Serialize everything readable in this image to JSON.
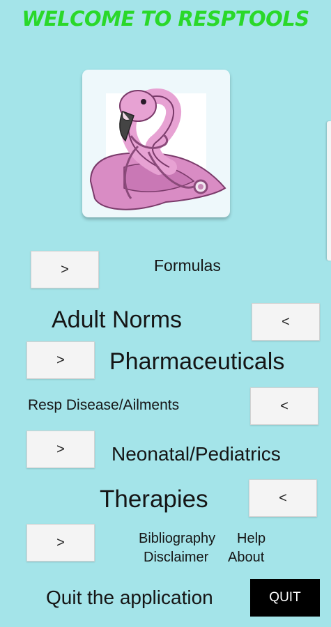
{
  "app": {
    "title": "WELCOME TO RESPTOOLS",
    "title_color": "#2ad82a",
    "background_color": "#a4e4e9",
    "logo_icon": "flamingo-with-stethoscope"
  },
  "menu": {
    "formulas": {
      "button_label": ">",
      "label": "Formulas"
    },
    "adult_norms": {
      "button_label": "<",
      "label": "Adult Norms"
    },
    "pharmaceuticals": {
      "button_label": ">",
      "label": "Pharmaceuticals"
    },
    "resp_disease": {
      "button_label": "<",
      "label": "Resp Disease/Ailments"
    },
    "neonatal": {
      "button_label": ">",
      "label": "Neonatal/Pediatrics"
    },
    "therapies": {
      "button_label": "<",
      "label": "Therapies"
    },
    "info": {
      "button_label": ">"
    }
  },
  "links": {
    "bibliography": "Bibliography",
    "help": "Help",
    "disclaimer": "Disclaimer",
    "about": "About"
  },
  "quit": {
    "label": "Quit the application",
    "button_label": "QUIT"
  }
}
